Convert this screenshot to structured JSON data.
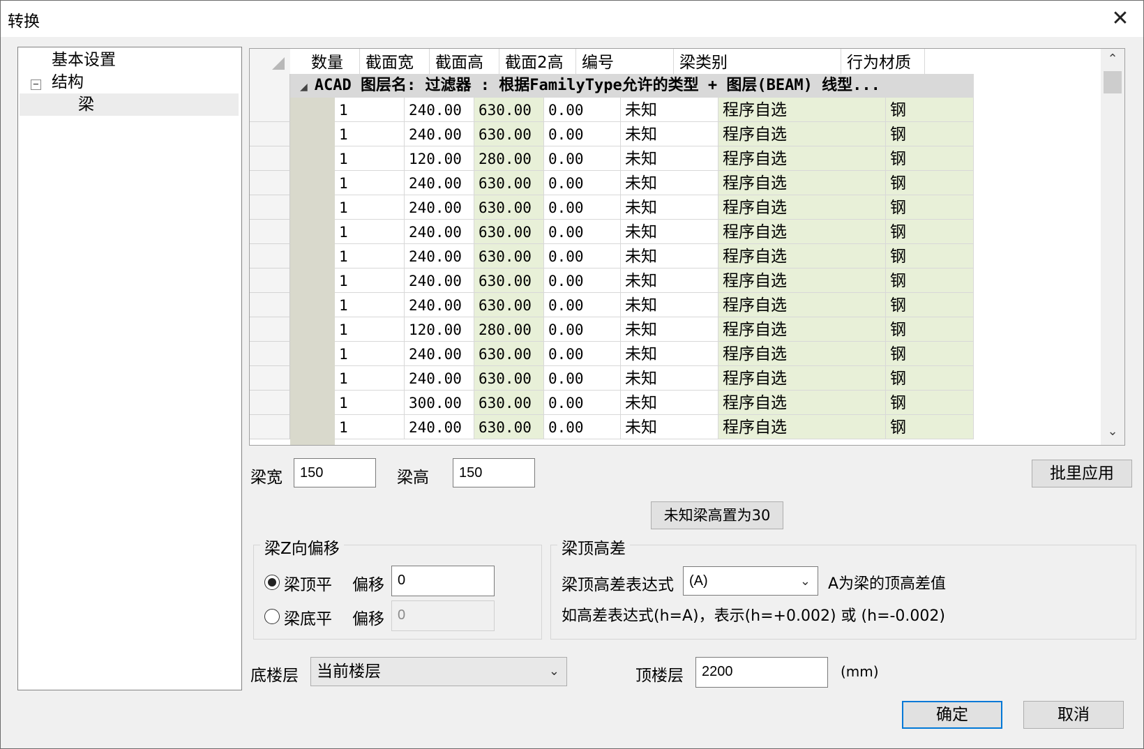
{
  "window": {
    "title": "转换",
    "close_glyph": "✕"
  },
  "tree": {
    "items": [
      {
        "label": "基本设置"
      },
      {
        "label": "结构",
        "expander": "−"
      },
      {
        "label": "梁"
      }
    ]
  },
  "grid": {
    "columns": [
      "数量",
      "截面宽",
      "截面高",
      "截面2高",
      "编号",
      "梁类别",
      "行为材质"
    ],
    "group_label": "ACAD 图层名:  过滤器 : 根据FamilyType允许的类型 + 图层(BEAM) 线型...",
    "rows": [
      [
        "1",
        "240.00",
        "630.00",
        "0.00",
        "未知",
        "程序自选",
        "钢"
      ],
      [
        "1",
        "240.00",
        "630.00",
        "0.00",
        "未知",
        "程序自选",
        "钢"
      ],
      [
        "1",
        "120.00",
        "280.00",
        "0.00",
        "未知",
        "程序自选",
        "钢"
      ],
      [
        "1",
        "240.00",
        "630.00",
        "0.00",
        "未知",
        "程序自选",
        "钢"
      ],
      [
        "1",
        "240.00",
        "630.00",
        "0.00",
        "未知",
        "程序自选",
        "钢"
      ],
      [
        "1",
        "240.00",
        "630.00",
        "0.00",
        "未知",
        "程序自选",
        "钢"
      ],
      [
        "1",
        "240.00",
        "630.00",
        "0.00",
        "未知",
        "程序自选",
        "钢"
      ],
      [
        "1",
        "240.00",
        "630.00",
        "0.00",
        "未知",
        "程序自选",
        "钢"
      ],
      [
        "1",
        "240.00",
        "630.00",
        "0.00",
        "未知",
        "程序自选",
        "钢"
      ],
      [
        "1",
        "120.00",
        "280.00",
        "0.00",
        "未知",
        "程序自选",
        "钢"
      ],
      [
        "1",
        "240.00",
        "630.00",
        "0.00",
        "未知",
        "程序自选",
        "钢"
      ],
      [
        "1",
        "240.00",
        "630.00",
        "0.00",
        "未知",
        "程序自选",
        "钢"
      ],
      [
        "1",
        "300.00",
        "630.00",
        "0.00",
        "未知",
        "程序自选",
        "钢"
      ],
      [
        "1",
        "240.00",
        "630.00",
        "0.00",
        "未知",
        "程序自选",
        "钢"
      ]
    ],
    "scroll_up": "⌃",
    "scroll_down": "⌄"
  },
  "form": {
    "beam_width_label": "梁宽",
    "beam_width_value": "150",
    "beam_height_label": "梁高",
    "beam_height_value": "150",
    "batch_apply": "批里应用",
    "unknown_height_button": "未知梁高置为30",
    "z_offset": {
      "legend": "梁Z向偏移",
      "top_flush": "梁顶平",
      "bottom_flush": "梁底平",
      "offset_label": "偏移",
      "top_offset_value": "0",
      "bottom_offset_value": "0"
    },
    "top_diff": {
      "legend": "梁顶高差",
      "expr_label": "梁顶高差表达式",
      "expr_value": "(A)",
      "expr_hint": "A为梁的顶高差值",
      "note": "如高差表达式(h=A)，表示(h=+0.002) 或 (h=-0.002)"
    },
    "bottom_floor_label": "底楼层",
    "bottom_floor_value": "当前楼层",
    "top_floor_label": "顶楼层",
    "top_floor_value": "2200",
    "unit": "(mm)",
    "ok": "确定",
    "cancel": "取消"
  }
}
